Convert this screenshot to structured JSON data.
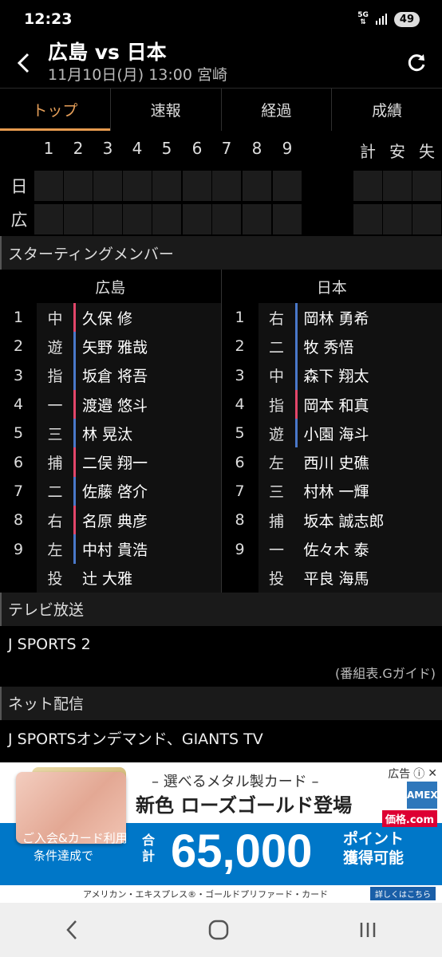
{
  "status": {
    "time": "12:23",
    "network": "5G",
    "battery": "49"
  },
  "header": {
    "title": "広島 vs 日本",
    "subtitle": "11月10日(月) 13:00 宮崎"
  },
  "tabs": [
    "トップ",
    "速報",
    "経過",
    "成績"
  ],
  "scoreboard": {
    "innings": [
      "1",
      "2",
      "3",
      "4",
      "5",
      "6",
      "7",
      "8",
      "9"
    ],
    "totals": [
      "計",
      "安",
      "失"
    ],
    "teams": [
      "日",
      "広"
    ]
  },
  "starting": {
    "heading": "スターティングメンバー",
    "left_team": "広島",
    "right_team": "日本",
    "left": [
      {
        "order": "1",
        "pos": "中",
        "name": "久保 修",
        "color": "red"
      },
      {
        "order": "2",
        "pos": "遊",
        "name": "矢野 雅哉",
        "color": "blue"
      },
      {
        "order": "3",
        "pos": "指",
        "name": "坂倉 将吾",
        "color": "blue"
      },
      {
        "order": "4",
        "pos": "一",
        "name": "渡邉 悠斗",
        "color": "red"
      },
      {
        "order": "5",
        "pos": "三",
        "name": "林 晃汰",
        "color": "blue"
      },
      {
        "order": "6",
        "pos": "捕",
        "name": "二俣 翔一",
        "color": "red"
      },
      {
        "order": "7",
        "pos": "二",
        "name": "佐藤 啓介",
        "color": "blue"
      },
      {
        "order": "8",
        "pos": "右",
        "name": "名原 典彦",
        "color": "red"
      },
      {
        "order": "9",
        "pos": "左",
        "name": "中村 貴浩",
        "color": "blue"
      },
      {
        "order": "",
        "pos": "投",
        "name": "辻 大雅",
        "color": "none"
      }
    ],
    "right": [
      {
        "order": "1",
        "pos": "右",
        "name": "岡林 勇希",
        "color": "blue"
      },
      {
        "order": "2",
        "pos": "二",
        "name": "牧 秀悟",
        "color": "blue"
      },
      {
        "order": "3",
        "pos": "中",
        "name": "森下 翔太",
        "color": "blue"
      },
      {
        "order": "4",
        "pos": "指",
        "name": "岡本 和真",
        "color": "red"
      },
      {
        "order": "5",
        "pos": "遊",
        "name": "小園 海斗",
        "color": "blue"
      },
      {
        "order": "6",
        "pos": "左",
        "name": "西川 史礁",
        "color": "none"
      },
      {
        "order": "7",
        "pos": "三",
        "name": "村林 一輝",
        "color": "none"
      },
      {
        "order": "8",
        "pos": "捕",
        "name": "坂本 誠志郎",
        "color": "none"
      },
      {
        "order": "9",
        "pos": "一",
        "name": "佐々木 泰",
        "color": "none"
      },
      {
        "order": "",
        "pos": "投",
        "name": "平良 海馬",
        "color": "none"
      }
    ]
  },
  "tv": {
    "heading": "テレビ放送",
    "channel": "J SPORTS 2",
    "source": "(番組表.Gガイド)"
  },
  "net": {
    "heading": "ネット配信",
    "services": "J SPORTSオンデマンド、GIANTS TV"
  },
  "ad": {
    "label": "広告",
    "line1": "– 選べるメタル製カード –",
    "line2": "新色 ローズゴールド登場",
    "brand": "価格.com",
    "amex": "AMEX",
    "cond1": "ご入会&カード利用",
    "cond2": "条件達成で",
    "total": "合計",
    "amount": "65,000",
    "point1": "ポイント",
    "point2": "獲得可能",
    "bottom": "アメリカン・エキスプレス®・ゴールドプリファード・カード",
    "detail": "詳しくはこちら"
  }
}
